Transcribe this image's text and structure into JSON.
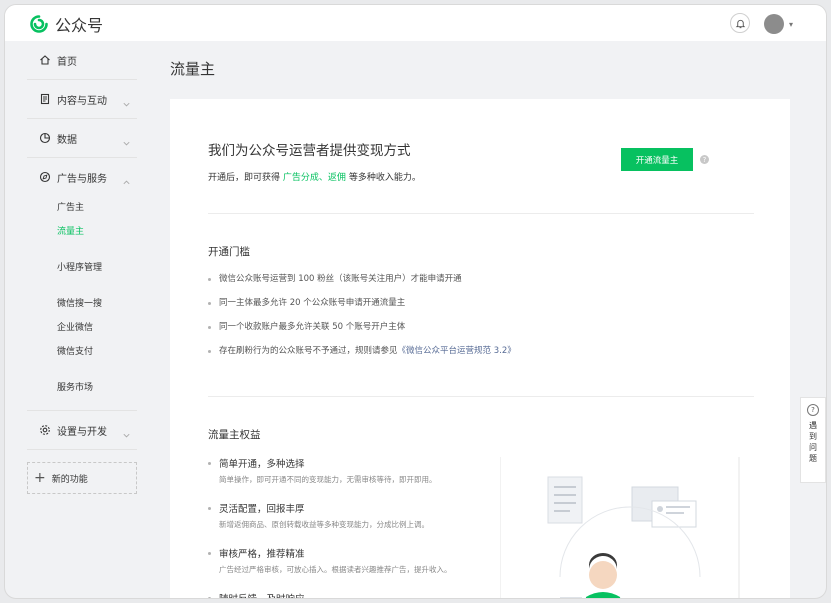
{
  "app": {
    "name": "公众号"
  },
  "sidebar": {
    "home": "首页",
    "content": "内容与互动",
    "data": "数据",
    "ads": "广告与服务",
    "ads_sub": [
      "广告主",
      "流量主",
      "小程序管理",
      "微信搜一搜",
      "企业微信",
      "微信支付",
      "服务市场"
    ],
    "settings": "设置与开发",
    "new_func": "新的功能"
  },
  "main": {
    "page_title": "流量主",
    "intro_title": "我们为公众号运营者提供变现方式",
    "intro_desc_prefix": "开通后，即可获得",
    "intro_desc_ad": "广告分成",
    "intro_desc_sep": "、",
    "intro_desc_rebate": "返佣",
    "intro_desc_suffix": "等多种收入能力。",
    "open_button": "开通流量主",
    "help_mark": "?",
    "threshold_title": "开通门槛",
    "requirements": [
      "微信公众账号运营到 100 粉丝（该账号关注用户）才能申请开通",
      "同一主体最多允许 20 个公众账号申请开通流量主",
      "同一个收款账户最多允许关联 50 个账号开户主体"
    ],
    "req_last_prefix": "存在刷粉行为的公众账号不予通过，规则请参见",
    "req_last_link": "《微信公众平台运营规范 3.2》",
    "benefits_title": "流量主权益",
    "benefits": [
      {
        "title": "简单开通，多种选择",
        "desc": "简单操作，即可开通不同的变现能力，无需审核等待，即开即用。"
      },
      {
        "title": "灵活配置，回报丰厚",
        "desc": "新增返佣商品、原创转载收益等多种变现能力，分成比例上调。"
      },
      {
        "title": "审核严格，推荐精准",
        "desc": "广告经过严格审核，可放心插入。根据读者兴趣推荐广告，提升收入。"
      },
      {
        "title": "随时反馈，及时响应",
        "desc": ""
      }
    ]
  },
  "help_float": {
    "icon": "?",
    "text": "遇到问题"
  },
  "colors": {
    "accent": "#07c160",
    "link": "#576b95"
  }
}
